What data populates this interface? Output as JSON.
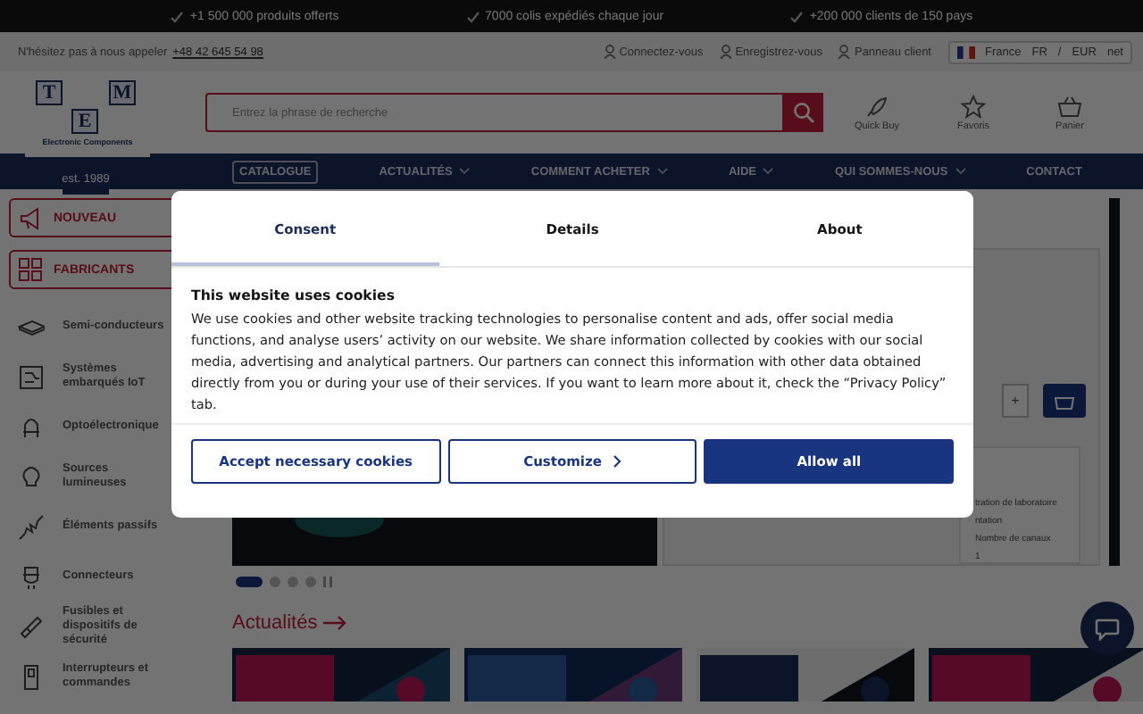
{
  "top_bar": {
    "items": [
      "+1 500 000 produits offerts",
      "7000 colis expédiés chaque jour",
      "+200 000 clients de 150 pays"
    ]
  },
  "util_bar": {
    "call_text": "N'hésitez pas à nous appeler",
    "phone": "+48 42 645 54 98",
    "links": [
      "Connectez-vous",
      "Enregistrez-vous",
      "Panneau client"
    ],
    "locale": {
      "country": "France",
      "language": "FR",
      "separator": "/",
      "currency": "EUR",
      "price_mode": "net"
    }
  },
  "header": {
    "logo": {
      "letters": [
        "T",
        "M",
        "E"
      ],
      "tagline": "Electronic Components",
      "since": "est. 1989"
    },
    "search": {
      "placeholder": "Entrez la phrase de recherche"
    },
    "actions": [
      "Quick Buy",
      "Favoris",
      "Panier"
    ]
  },
  "nav": [
    {
      "label": "CATALOGUE",
      "boxed": true,
      "dropdown": false
    },
    {
      "label": "ACTUALITÉS",
      "boxed": false,
      "dropdown": true
    },
    {
      "label": "COMMENT ACHETER",
      "boxed": false,
      "dropdown": true
    },
    {
      "label": "AIDE",
      "boxed": false,
      "dropdown": true
    },
    {
      "label": "QUI SOMMES-NOUS",
      "boxed": false,
      "dropdown": true
    },
    {
      "label": "CONTACT",
      "boxed": false,
      "dropdown": false
    }
  ],
  "sidebar": {
    "buttons": [
      "NOUVEAU",
      "FABRICANTS"
    ],
    "categories": [
      "Semi-conducteurs",
      "Systèmes embarqués IoT",
      "Optoélectronique",
      "Sources lumineuses",
      "Éléments passifs",
      "Connecteurs",
      "Fusibles et dispositifs de sécurité",
      "Interrupteurs et commandes"
    ]
  },
  "product_panel": {
    "quantity_button": "+",
    "specs": [
      "tration de laboratoire",
      "ntation",
      "Nombre de canaux",
      "1"
    ]
  },
  "carousel": {
    "dots": [
      {
        "selected": true
      },
      {
        "selected": false
      },
      {
        "selected": false
      },
      {
        "selected": false
      }
    ]
  },
  "news": {
    "title": "Actualités"
  },
  "cookie_dialog": {
    "tabs": [
      {
        "label": "Consent",
        "selected": true
      },
      {
        "label": "Details",
        "selected": false
      },
      {
        "label": "About",
        "selected": false
      }
    ],
    "title": "This website uses cookies",
    "body": "We use cookies and other website tracking technologies to personalise content and ads, offer social media functions, and analyse users’ activity on our website. We share information collected by cookies with our social media, advertising and analytical partners. Our partners can connect this information with other data obtained directly from you or during your use of their services. If you want to learn more about it, check the “Privacy Policy” tab.",
    "buttons": [
      {
        "label": "Accept necessary cookies",
        "kind": "outline"
      },
      {
        "label": "Customize",
        "kind": "chevron"
      },
      {
        "label": "Allow all",
        "kind": "primary"
      }
    ]
  }
}
